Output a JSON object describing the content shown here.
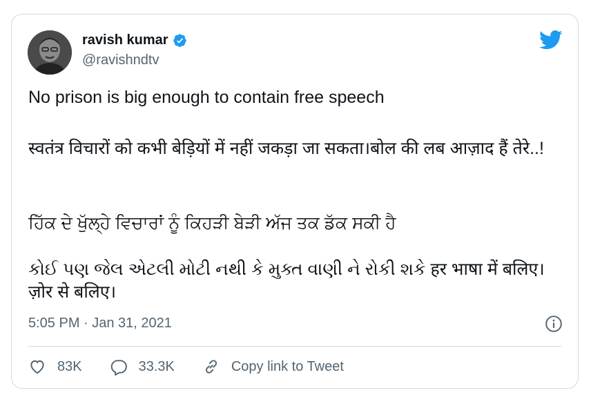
{
  "tweet": {
    "author": {
      "name": "ravish kumar",
      "handle": "@ravishndtv",
      "verified": true
    },
    "lines": [
      "No prison is big enough to contain free speech",
      "स्वतंत्र विचारों को कभी बेड़ियों में नहीं जकड़ा जा सकता।बोल की लब आज़ाद हैं तेरे..!",
      "ਹਿੱਕ ਦੇ ਖੁੱਲ੍ਹੇ ਵਿਚਾਰਾਂ ਨੂੰ ਕਿਹੜੀ ਬੇੜੀ ਅੱਜ ਤਕ ਡੱਕ ਸਕੀ ਹੈ",
      "કોઈ પણ જેલ એટલી મોટી નથી કે મુક્ત વાણી ને રોકી શકે हर भाषा में बलिए। ज़ोर से बलिए।"
    ],
    "timestamp": "5:05 PM · Jan 31, 2021",
    "likes": "83K",
    "replies": "33.3K",
    "copy_link_label": "Copy link to Tweet",
    "icons": {
      "brand": "twitter-bird-icon",
      "verified": "verified-badge-icon",
      "info": "info-icon",
      "like": "heart-icon",
      "reply": "reply-bubble-icon",
      "link": "link-icon"
    },
    "colors": {
      "brand_blue": "#1d9bf0",
      "text": "#0f1419",
      "secondary": "#536471",
      "border": "#cfd9de"
    }
  }
}
